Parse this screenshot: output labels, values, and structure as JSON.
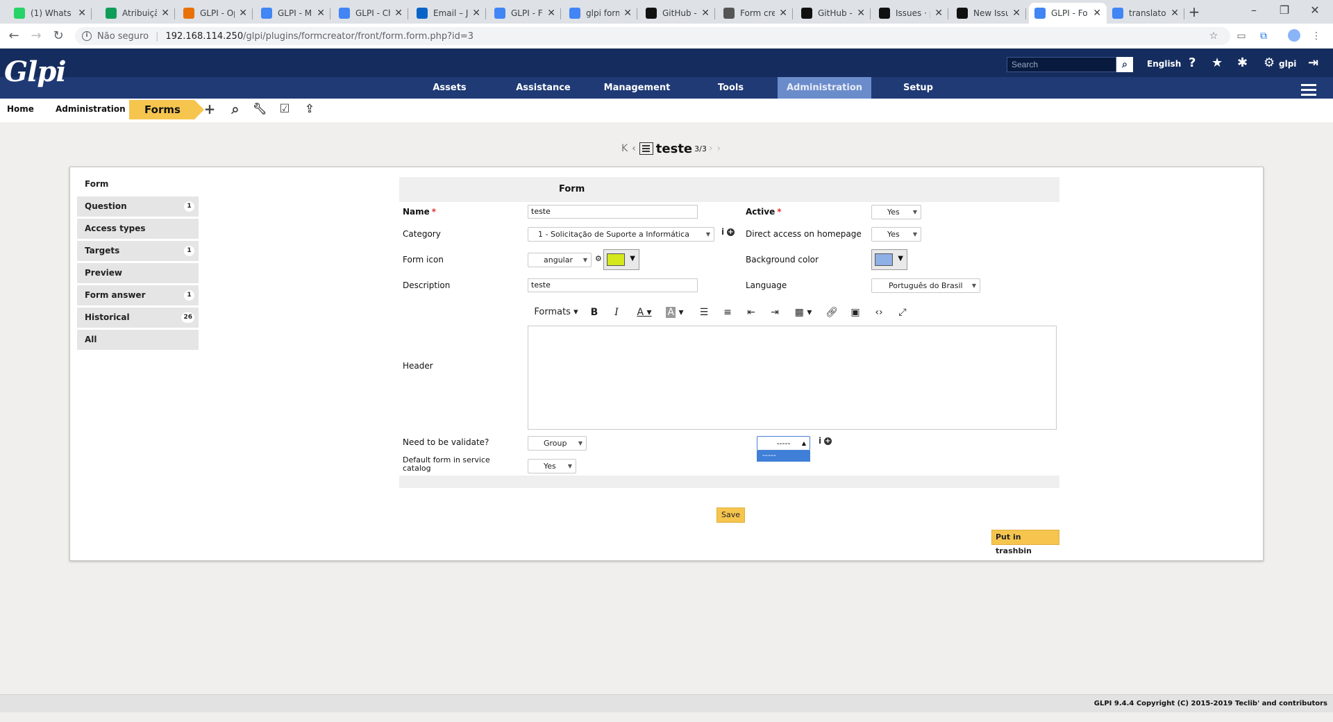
{
  "browser": {
    "tabs": [
      {
        "title": "(1) Whats",
        "icon": "whatsapp-icon",
        "color": "#25d366"
      },
      {
        "title": "Atribuiçã",
        "icon": "sheets-icon",
        "color": "#0f9d58"
      },
      {
        "title": "GLPI - Op",
        "icon": "glpi-chart-icon",
        "color": "#e8710a"
      },
      {
        "title": "GLPI - Mu",
        "icon": "google-icon",
        "color": "#4285f4"
      },
      {
        "title": "GLPI - Ch",
        "icon": "google-icon",
        "color": "#4285f4"
      },
      {
        "title": "Email – Ju",
        "icon": "outlook-icon",
        "color": "#0a64c8"
      },
      {
        "title": "GLPI - Fo",
        "icon": "google-icon",
        "color": "#4285f4"
      },
      {
        "title": "glpi form",
        "icon": "google-icon",
        "color": "#4285f4"
      },
      {
        "title": "GitHub -",
        "icon": "github-icon",
        "color": "#111111"
      },
      {
        "title": "Form cre",
        "icon": "document-icon",
        "color": "#555555"
      },
      {
        "title": "GitHub -",
        "icon": "github-icon",
        "color": "#111111"
      },
      {
        "title": "Issues · p",
        "icon": "github-icon",
        "color": "#111111"
      },
      {
        "title": "New Issu",
        "icon": "github-icon",
        "color": "#111111"
      },
      {
        "title": "GLPI - Fo",
        "icon": "google-icon",
        "color": "#4285f4",
        "active": true
      },
      {
        "title": "translato",
        "icon": "google-icon",
        "color": "#4285f4"
      }
    ],
    "security": "Não seguro",
    "url_host": "192.168.114.250",
    "url_path": "/glpi/plugins/formcreator/front/form.form.php?id=3"
  },
  "glpi": {
    "logo": "Glpi",
    "search_placeholder": "Search",
    "language": "English",
    "user": "glpi",
    "menu": [
      "Assets",
      "Assistance",
      "Management",
      "Tools",
      "Administration",
      "Setup"
    ],
    "active_menu": "Administration",
    "breadcrumb": {
      "home": "Home",
      "section": "Administration",
      "current": "Forms"
    }
  },
  "record": {
    "title": "teste",
    "position": "3/3"
  },
  "side_tabs": [
    {
      "label": "Form",
      "count": ""
    },
    {
      "label": "Question",
      "count": "1"
    },
    {
      "label": "Access types",
      "count": ""
    },
    {
      "label": "Targets",
      "count": "1"
    },
    {
      "label": "Preview",
      "count": ""
    },
    {
      "label": "Form answer",
      "count": "1"
    },
    {
      "label": "Historical",
      "count": "26"
    },
    {
      "label": "All",
      "count": ""
    }
  ],
  "form": {
    "header_title": "Form",
    "name_label": "Name",
    "name_value": "teste",
    "active_label": "Active",
    "active_value": "Yes",
    "category_label": "Category",
    "category_value": "1 - Solicitação de Suporte a Informática",
    "direct_access_label": "Direct access on homepage",
    "direct_access_value": "Yes",
    "icon_label": "Form icon",
    "icon_value": "angular",
    "icon_color": "#d4e81a",
    "bg_color_label": "Background color",
    "bg_color": "#8fb0e6",
    "description_label": "Description",
    "description_value": "teste",
    "language_label": "Language",
    "language_value": "Português do Brasil",
    "header_label": "Header",
    "editor_formats": "Formats",
    "validate_label": "Need to be validate?",
    "validate_value": "Group",
    "validator_value": "-----",
    "validator_option": "-----",
    "default_catalog_label": "Default form in service catalog",
    "default_catalog_value": "Yes",
    "required_mark": "*",
    "save_label": "Save",
    "trash_label": "Put in trashbin"
  },
  "footer": "GLPI 9.4.4 Copyright (C) 2015-2019 Teclib' and contributors"
}
